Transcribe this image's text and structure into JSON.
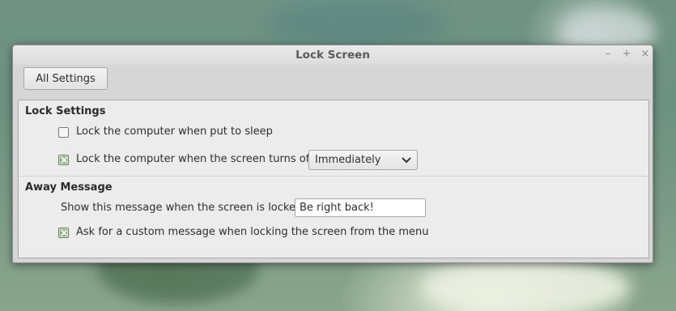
{
  "window": {
    "title": "Lock Screen",
    "controls": {
      "minimize": "–",
      "maximize": "+",
      "close": "×"
    }
  },
  "toolbar": {
    "all_settings_label": "All Settings"
  },
  "lock_settings": {
    "heading": "Lock Settings",
    "sleep_lock": {
      "label": "Lock the computer when put to sleep",
      "checked": false
    },
    "screen_off_lock": {
      "label": "Lock the computer when the screen turns off",
      "checked": true,
      "delay_selected": "Immediately"
    }
  },
  "away_message": {
    "heading": "Away Message",
    "message_label": "Show this message when the screen is locked:",
    "message_value": "Be right back!",
    "custom_message": {
      "label": "Ask for a custom message when locking the screen from the menu",
      "checked": true
    }
  },
  "icons": {
    "combo_arrow": "chevron-down-icon",
    "checkbox_mark": "checkmark-x-icon"
  },
  "colors": {
    "window_bg": "#d6d6d6",
    "content_bg": "#ececec",
    "checkbox_checked": "#8aa77a"
  }
}
